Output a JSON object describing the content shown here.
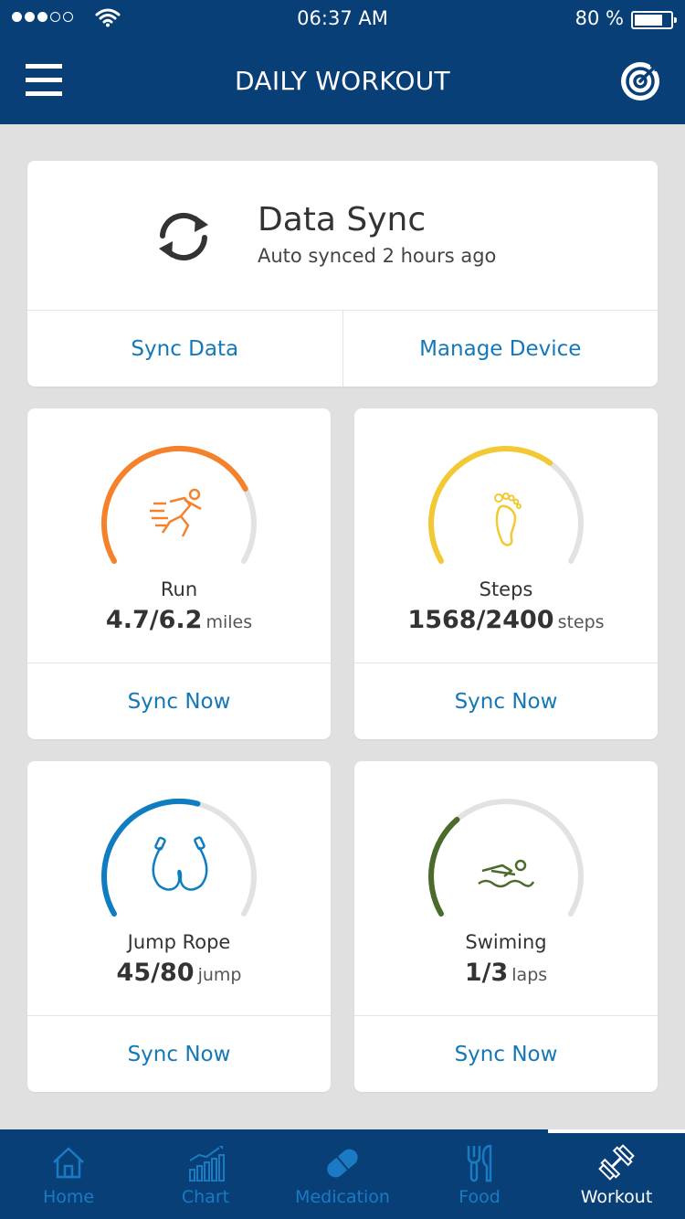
{
  "status_bar": {
    "time": "06:37 AM",
    "battery_pct": "80 %",
    "battery_level": 0.8,
    "signal_dots_filled": 3,
    "signal_dots_total": 5
  },
  "navbar": {
    "title": "DAILY WORKOUT",
    "menu_icon": "hamburger-menu-icon",
    "action_icon": "target-icon"
  },
  "data_sync": {
    "title": "Data Sync",
    "subtitle": "Auto synced 2 hours ago",
    "icon": "sync-icon",
    "sync_data_label": "Sync Data",
    "manage_device_label": "Manage Device"
  },
  "metrics": [
    {
      "name": "Run",
      "value": "4.7/6.2",
      "unit": "miles",
      "progress": 0.76,
      "color": "#f5822b",
      "icon": "runner-icon",
      "action": "Sync Now"
    },
    {
      "name": "Steps",
      "value": "1568/2400",
      "unit": "steps",
      "progress": 0.65,
      "color": "#f2c933",
      "icon": "footprint-icon",
      "action": "Sync Now"
    },
    {
      "name": "Jump Rope",
      "value": "45/80",
      "unit": "jump",
      "progress": 0.56,
      "color": "#0f7dc2",
      "icon": "jump-rope-icon",
      "action": "Sync Now"
    },
    {
      "name": "Swiming",
      "value": "1/3",
      "unit": "laps",
      "progress": 0.33,
      "color": "#4a6b2a",
      "icon": "swimmer-icon",
      "action": "Sync Now"
    }
  ],
  "gauge_track_color": "#e2e2e2",
  "tabs": [
    {
      "label": "Home",
      "icon": "home-icon",
      "active": false
    },
    {
      "label": "Chart",
      "icon": "bar-chart-icon",
      "active": false
    },
    {
      "label": "Medication",
      "icon": "pill-icon",
      "active": false
    },
    {
      "label": "Food",
      "icon": "fork-knife-icon",
      "active": false
    },
    {
      "label": "Workout",
      "icon": "dumbbell-icon",
      "active": true
    }
  ],
  "colors": {
    "primary": "#073f76",
    "link": "#1478b8",
    "tab_inactive": "#1a7bc4",
    "background": "#e1e0e0"
  }
}
